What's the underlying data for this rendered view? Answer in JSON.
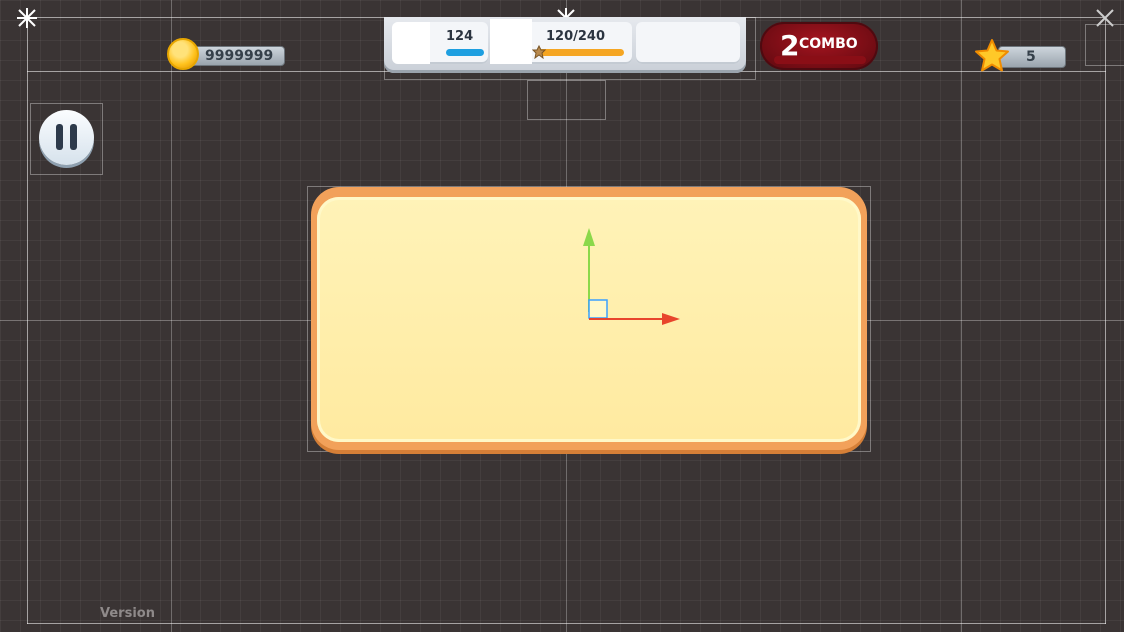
{
  "hud": {
    "coins": "9999999",
    "stat_value": "124",
    "cookie_progress": "120/240",
    "combo_count": "2",
    "combo_label": "COMBO",
    "stars": "5"
  },
  "footer": {
    "version_label": "Version"
  },
  "icons": [
    "coin-icon",
    "cookie-icon",
    "star-icon",
    "pause-icon",
    "move-gizmo-icon",
    "anchor-icon"
  ],
  "colors": {
    "board_orange": "#f2a15a",
    "board_fill": "#ffeaa0",
    "combo_red": "#a4141f",
    "progress_blue": "#1e9fe0",
    "progress_orange": "#f5a623",
    "gizmo_y": "#8bd84a",
    "gizmo_x": "#e8452c"
  }
}
